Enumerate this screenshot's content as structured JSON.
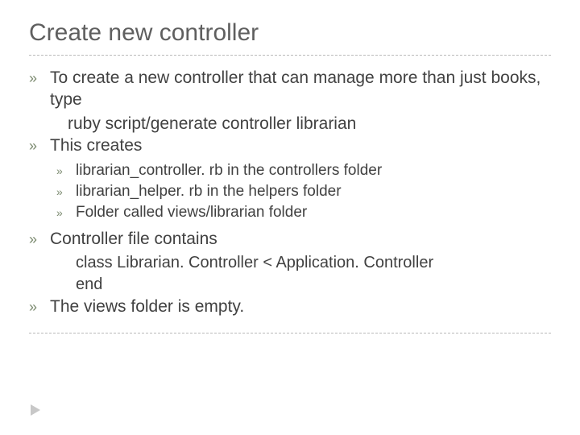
{
  "title": "Create new controller",
  "bullet_glyph": "»",
  "items": [
    {
      "text": "To create a new controller that can manage more than just books, type",
      "sublines": [
        "ruby script/generate controller librarian"
      ]
    },
    {
      "text": "This creates",
      "subitems": [
        "librarian_controller. rb in the controllers folder",
        "librarian_helper. rb in the helpers folder",
        "Folder called views/librarian folder"
      ]
    },
    {
      "text": "Controller file contains",
      "codelines": [
        "class Librarian. Controller < Application. Controller",
        "end"
      ]
    },
    {
      "text": "The views folder is empty."
    }
  ]
}
